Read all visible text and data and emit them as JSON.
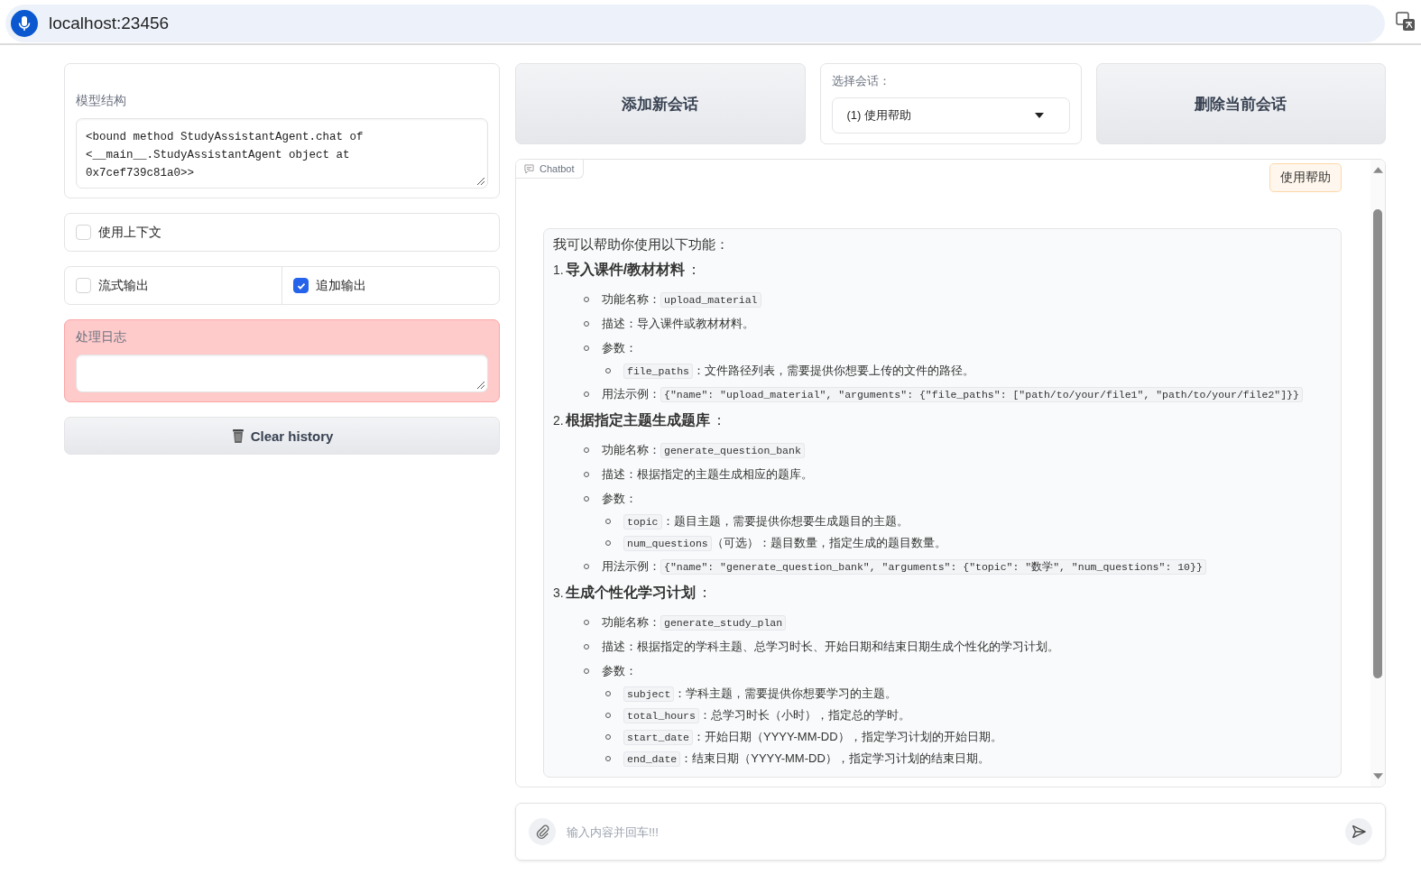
{
  "address_bar": {
    "url": "localhost:23456"
  },
  "model_structure": {
    "label": "模型结构",
    "value": "<bound method StudyAssistantAgent.chat of\n<__main__.StudyAssistantAgent object at\n0x7cef739c81a0>>"
  },
  "options": [
    {
      "label": "使用上下文",
      "checked": false
    }
  ],
  "options_row": [
    {
      "label": "流式输出",
      "checked": false
    },
    {
      "label": "追加输出",
      "checked": true
    }
  ],
  "log": {
    "label": "处理日志"
  },
  "clear_button": {
    "label": "Clear history"
  },
  "add_session_button": {
    "label": "添加新会话"
  },
  "session_select": {
    "label": "选择会话：",
    "value": "(1)  使用帮助"
  },
  "delete_session_button": {
    "label": "删除当前会话"
  },
  "chatbot": {
    "label": "Chatbot",
    "user_message": "使用帮助",
    "reply": {
      "intro": "我可以帮助你使用以下功能：",
      "sections": [
        {
          "number": "1.",
          "title": "导入课件/教材材料",
          "suffix": "：",
          "items": [
            {
              "segments": [
                {
                  "kind": "text",
                  "text": "功能名称："
                },
                {
                  "kind": "code",
                  "text": "upload_material"
                }
              ]
            },
            {
              "segments": [
                {
                  "kind": "text",
                  "text": "描述：导入课件或教材材料。"
                }
              ]
            },
            {
              "segments": [
                {
                  "kind": "text",
                  "text": "参数："
                }
              ],
              "children": [
                {
                  "segments": [
                    {
                      "kind": "code",
                      "text": "file_paths"
                    },
                    {
                      "kind": "text",
                      "text": "：文件路径列表，需要提供你想要上传的文件的路径。"
                    }
                  ]
                }
              ]
            },
            {
              "segments": [
                {
                  "kind": "text",
                  "text": "用法示例："
                },
                {
                  "kind": "code",
                  "text": "{\"name\": \"upload_material\", \"arguments\": {\"file_paths\": [\"path/to/your/file1\", \"path/to/your/file2\"]}}"
                }
              ]
            }
          ]
        },
        {
          "number": "2.",
          "title": "根据指定主题生成题库",
          "suffix": "：",
          "items": [
            {
              "segments": [
                {
                  "kind": "text",
                  "text": "功能名称："
                },
                {
                  "kind": "code",
                  "text": "generate_question_bank"
                }
              ]
            },
            {
              "segments": [
                {
                  "kind": "text",
                  "text": "描述：根据指定的主题生成相应的题库。"
                }
              ]
            },
            {
              "segments": [
                {
                  "kind": "text",
                  "text": "参数："
                }
              ],
              "children": [
                {
                  "segments": [
                    {
                      "kind": "code",
                      "text": "topic"
                    },
                    {
                      "kind": "text",
                      "text": "：题目主题，需要提供你想要生成题目的主题。"
                    }
                  ]
                },
                {
                  "segments": [
                    {
                      "kind": "code",
                      "text": "num_questions"
                    },
                    {
                      "kind": "text",
                      "text": "（可选）：题目数量，指定生成的题目数量。"
                    }
                  ]
                }
              ]
            },
            {
              "segments": [
                {
                  "kind": "text",
                  "text": "用法示例："
                },
                {
                  "kind": "code",
                  "text": "{\"name\": \"generate_question_bank\", \"arguments\": {\"topic\": \"数学\", \"num_questions\": 10}}"
                }
              ]
            }
          ]
        },
        {
          "number": "3.",
          "title": "生成个性化学习计划",
          "suffix": "：",
          "items": [
            {
              "segments": [
                {
                  "kind": "text",
                  "text": "功能名称："
                },
                {
                  "kind": "code",
                  "text": "generate_study_plan"
                }
              ]
            },
            {
              "segments": [
                {
                  "kind": "text",
                  "text": "描述：根据指定的学科主题、总学习时长、开始日期和结束日期生成个性化的学习计划。"
                }
              ]
            },
            {
              "segments": [
                {
                  "kind": "text",
                  "text": "参数："
                }
              ],
              "children": [
                {
                  "segments": [
                    {
                      "kind": "code",
                      "text": "subject"
                    },
                    {
                      "kind": "text",
                      "text": "：学科主题，需要提供你想要学习的主题。"
                    }
                  ]
                },
                {
                  "segments": [
                    {
                      "kind": "code",
                      "text": "total_hours"
                    },
                    {
                      "kind": "text",
                      "text": "：总学习时长（小时），指定总的学时。"
                    }
                  ]
                },
                {
                  "segments": [
                    {
                      "kind": "code",
                      "text": "start_date"
                    },
                    {
                      "kind": "text",
                      "text": "：开始日期（YYYY-MM-DD），指定学习计划的开始日期。"
                    }
                  ]
                },
                {
                  "segments": [
                    {
                      "kind": "code",
                      "text": "end_date"
                    },
                    {
                      "kind": "text",
                      "text": "：结束日期（YYYY-MM-DD），指定学习计划的结束日期。"
                    }
                  ]
                }
              ]
            }
          ]
        }
      ]
    }
  },
  "message_input": {
    "placeholder": "输入内容并回车!!!"
  }
}
